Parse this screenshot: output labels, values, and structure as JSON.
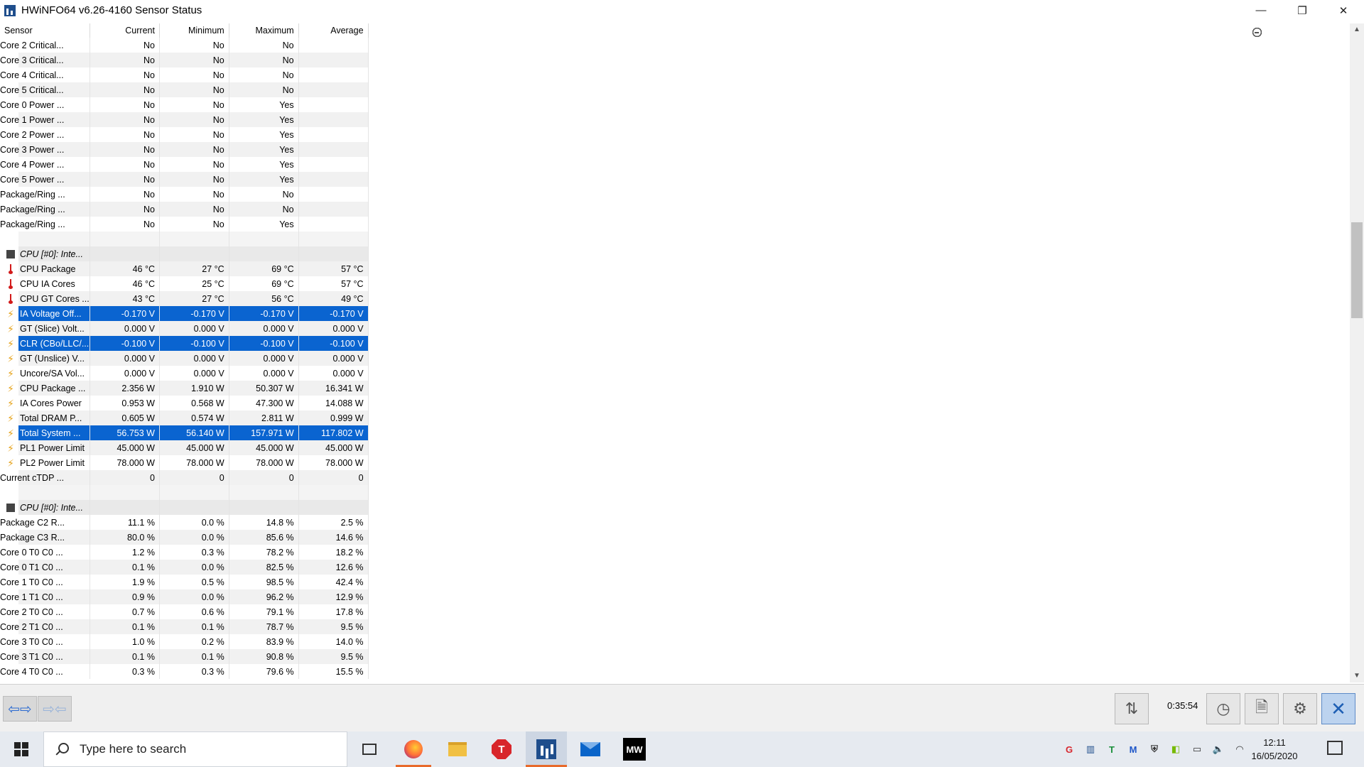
{
  "window": {
    "title": "HWiNFO64 v6.26-4160 Sensor Status",
    "minimize": "—",
    "maximize": "❐",
    "close": "✕"
  },
  "columns": {
    "sensor": "Sensor",
    "current": "Current",
    "minimum": "Minimum",
    "maximum": "Maximum",
    "average": "Average"
  },
  "rows": [
    {
      "type": "row",
      "icon": "clock-icon",
      "name": "Core 2 Critical...",
      "cur": "No",
      "min": "No",
      "max": "No",
      "avg": ""
    },
    {
      "type": "row",
      "icon": "clock-icon",
      "name": "Core 3 Critical...",
      "cur": "No",
      "min": "No",
      "max": "No",
      "avg": ""
    },
    {
      "type": "row",
      "icon": "clock-icon",
      "name": "Core 4 Critical...",
      "cur": "No",
      "min": "No",
      "max": "No",
      "avg": ""
    },
    {
      "type": "row",
      "icon": "clock-icon",
      "name": "Core 5 Critical...",
      "cur": "No",
      "min": "No",
      "max": "No",
      "avg": ""
    },
    {
      "type": "row",
      "icon": "clock-icon",
      "name": "Core 0 Power ...",
      "cur": "No",
      "min": "No",
      "max": "Yes",
      "avg": ""
    },
    {
      "type": "row",
      "icon": "clock-icon",
      "name": "Core 1 Power ...",
      "cur": "No",
      "min": "No",
      "max": "Yes",
      "avg": ""
    },
    {
      "type": "row",
      "icon": "clock-icon",
      "name": "Core 2 Power ...",
      "cur": "No",
      "min": "No",
      "max": "Yes",
      "avg": ""
    },
    {
      "type": "row",
      "icon": "clock-icon",
      "name": "Core 3 Power ...",
      "cur": "No",
      "min": "No",
      "max": "Yes",
      "avg": ""
    },
    {
      "type": "row",
      "icon": "clock-icon",
      "name": "Core 4 Power ...",
      "cur": "No",
      "min": "No",
      "max": "Yes",
      "avg": ""
    },
    {
      "type": "row",
      "icon": "clock-icon",
      "name": "Core 5 Power ...",
      "cur": "No",
      "min": "No",
      "max": "Yes",
      "avg": ""
    },
    {
      "type": "row",
      "icon": "clock-icon",
      "name": "Package/Ring ...",
      "cur": "No",
      "min": "No",
      "max": "No",
      "avg": ""
    },
    {
      "type": "row",
      "icon": "clock-icon",
      "name": "Package/Ring ...",
      "cur": "No",
      "min": "No",
      "max": "No",
      "avg": ""
    },
    {
      "type": "row",
      "icon": "clock-icon",
      "name": "Package/Ring ...",
      "cur": "No",
      "min": "No",
      "max": "Yes",
      "avg": ""
    },
    {
      "type": "blank"
    },
    {
      "type": "group",
      "icon": "chip-icon",
      "name": "CPU [#0]: Inte..."
    },
    {
      "type": "row",
      "icon": "thermometer-icon",
      "name": "CPU Package",
      "cur": "46 °C",
      "min": "27 °C",
      "max": "69 °C",
      "avg": "57 °C"
    },
    {
      "type": "row",
      "icon": "thermometer-icon",
      "name": "CPU IA Cores",
      "cur": "46 °C",
      "min": "25 °C",
      "max": "69 °C",
      "avg": "57 °C"
    },
    {
      "type": "row",
      "icon": "thermometer-icon",
      "name": "CPU GT Cores ...",
      "cur": "43 °C",
      "min": "27 °C",
      "max": "56 °C",
      "avg": "49 °C"
    },
    {
      "type": "row",
      "icon": "bolt-icon",
      "name": "IA Voltage Off...",
      "cur": "-0.170 V",
      "min": "-0.170 V",
      "max": "-0.170 V",
      "avg": "-0.170 V",
      "selected": true
    },
    {
      "type": "row",
      "icon": "bolt-icon",
      "name": "GT (Slice) Volt...",
      "cur": "0.000 V",
      "min": "0.000 V",
      "max": "0.000 V",
      "avg": "0.000 V"
    },
    {
      "type": "row",
      "icon": "bolt-icon",
      "name": "CLR (CBo/LLC/...",
      "cur": "-0.100 V",
      "min": "-0.100 V",
      "max": "-0.100 V",
      "avg": "-0.100 V",
      "selected": true
    },
    {
      "type": "row",
      "icon": "bolt-icon",
      "name": "GT (Unslice) V...",
      "cur": "0.000 V",
      "min": "0.000 V",
      "max": "0.000 V",
      "avg": "0.000 V"
    },
    {
      "type": "row",
      "icon": "bolt-icon",
      "name": "Uncore/SA Vol...",
      "cur": "0.000 V",
      "min": "0.000 V",
      "max": "0.000 V",
      "avg": "0.000 V"
    },
    {
      "type": "row",
      "icon": "bolt-icon",
      "name": "CPU Package ...",
      "cur": "2.356 W",
      "min": "1.910 W",
      "max": "50.307 W",
      "avg": "16.341 W"
    },
    {
      "type": "row",
      "icon": "bolt-icon",
      "name": "IA Cores Power",
      "cur": "0.953 W",
      "min": "0.568 W",
      "max": "47.300 W",
      "avg": "14.088 W"
    },
    {
      "type": "row",
      "icon": "bolt-icon",
      "name": "Total DRAM P...",
      "cur": "0.605 W",
      "min": "0.574 W",
      "max": "2.811 W",
      "avg": "0.999 W"
    },
    {
      "type": "row",
      "icon": "bolt-icon",
      "name": "Total System ...",
      "cur": "56.753 W",
      "min": "56.140 W",
      "max": "157.971 W",
      "avg": "117.802 W",
      "selected": true
    },
    {
      "type": "row",
      "icon": "bolt-icon",
      "name": "PL1 Power Limit",
      "cur": "45.000 W",
      "min": "45.000 W",
      "max": "45.000 W",
      "avg": "45.000 W"
    },
    {
      "type": "row",
      "icon": "bolt-icon",
      "name": "PL2 Power Limit",
      "cur": "78.000 W",
      "min": "78.000 W",
      "max": "78.000 W",
      "avg": "78.000 W"
    },
    {
      "type": "row",
      "icon": "clock-icon",
      "name": "Current cTDP ...",
      "cur": "0",
      "min": "0",
      "max": "0",
      "avg": "0"
    },
    {
      "type": "blank"
    },
    {
      "type": "group",
      "icon": "chip-icon",
      "name": "CPU [#0]: Inte..."
    },
    {
      "type": "row",
      "icon": "clock-icon",
      "name": "Package C2 R...",
      "cur": "11.1 %",
      "min": "0.0 %",
      "max": "14.8 %",
      "avg": "2.5 %"
    },
    {
      "type": "row",
      "icon": "clock-icon",
      "name": "Package C3 R...",
      "cur": "80.0 %",
      "min": "0.0 %",
      "max": "85.6 %",
      "avg": "14.6 %"
    },
    {
      "type": "row",
      "icon": "clock-icon",
      "name": "Core 0 T0 C0 ...",
      "cur": "1.2 %",
      "min": "0.3 %",
      "max": "78.2 %",
      "avg": "18.2 %"
    },
    {
      "type": "row",
      "icon": "clock-icon",
      "name": "Core 0 T1 C0 ...",
      "cur": "0.1 %",
      "min": "0.0 %",
      "max": "82.5 %",
      "avg": "12.6 %"
    },
    {
      "type": "row",
      "icon": "clock-icon",
      "name": "Core 1 T0 C0 ...",
      "cur": "1.9 %",
      "min": "0.5 %",
      "max": "98.5 %",
      "avg": "42.4 %"
    },
    {
      "type": "row",
      "icon": "clock-icon",
      "name": "Core 1 T1 C0 ...",
      "cur": "0.9 %",
      "min": "0.0 %",
      "max": "96.2 %",
      "avg": "12.9 %"
    },
    {
      "type": "row",
      "icon": "clock-icon",
      "name": "Core 2 T0 C0 ...",
      "cur": "0.7 %",
      "min": "0.6 %",
      "max": "79.1 %",
      "avg": "17.8 %"
    },
    {
      "type": "row",
      "icon": "clock-icon",
      "name": "Core 2 T1 C0 ...",
      "cur": "0.1 %",
      "min": "0.1 %",
      "max": "78.7 %",
      "avg": "9.5 %"
    },
    {
      "type": "row",
      "icon": "clock-icon",
      "name": "Core 3 T0 C0 ...",
      "cur": "1.0 %",
      "min": "0.2 %",
      "max": "83.9 %",
      "avg": "14.0 %"
    },
    {
      "type": "row",
      "icon": "clock-icon",
      "name": "Core 3 T1 C0 ...",
      "cur": "0.1 %",
      "min": "0.1 %",
      "max": "90.8 %",
      "avg": "9.5 %"
    },
    {
      "type": "row",
      "icon": "clock-icon",
      "name": "Core 4 T0 C0 ...",
      "cur": "0.3 %",
      "min": "0.3 %",
      "max": "79.6 %",
      "avg": "15.5 %"
    }
  ],
  "toolbar": {
    "elapsed": "0:35:54",
    "nav_back_forward": "⇦⇨",
    "nav_collapse": "⇨⇦",
    "network_icon_glyph": "⇅",
    "clock_icon_glyph": "◷",
    "report_icon_glyph": "🗎",
    "settings_icon_glyph": "⚙",
    "close_glyph": "✕"
  },
  "taskbar": {
    "search_placeholder": "Type here to search",
    "app_t_label": "T",
    "app_mw_label": "MW",
    "time": "12:11",
    "date": "16/05/2020",
    "tray": [
      {
        "name": "tray-red-app-icon",
        "glyph": "G",
        "color": "#d7282f"
      },
      {
        "name": "tray-hwinfo-icon",
        "glyph": "▥",
        "color": "#1f4e8c"
      },
      {
        "name": "tray-green-t-icon",
        "glyph": "T",
        "color": "#1a8f3a"
      },
      {
        "name": "tray-malwarebytes-icon",
        "glyph": "M",
        "color": "#1e56c8"
      },
      {
        "name": "tray-shield-icon",
        "glyph": "⛨",
        "color": "#333333"
      },
      {
        "name": "tray-nvidia-icon",
        "glyph": "◧",
        "color": "#76b900"
      },
      {
        "name": "tray-battery-icon",
        "glyph": "▭",
        "color": "#333333"
      },
      {
        "name": "tray-volume-icon",
        "glyph": "🔈",
        "color": "#333333"
      },
      {
        "name": "tray-wifi-icon",
        "glyph": "◠",
        "color": "#333333"
      }
    ]
  },
  "colors": {
    "selection": "#0a64d0",
    "group_row": "#e9e9e9",
    "alt_row": "#f1f1f1"
  }
}
